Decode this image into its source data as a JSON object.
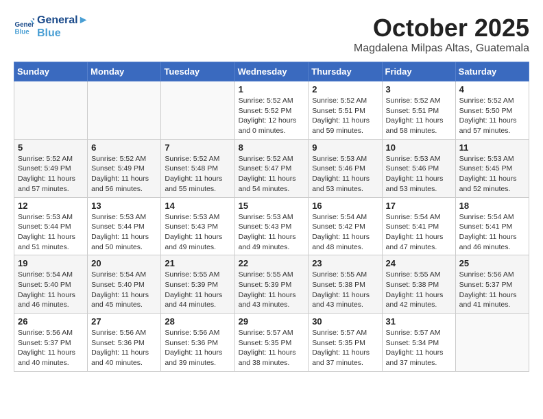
{
  "header": {
    "logo_line1": "General",
    "logo_line2": "Blue",
    "month": "October 2025",
    "location": "Magdalena Milpas Altas, Guatemala"
  },
  "weekdays": [
    "Sunday",
    "Monday",
    "Tuesday",
    "Wednesday",
    "Thursday",
    "Friday",
    "Saturday"
  ],
  "weeks": [
    [
      {
        "day": "",
        "info": ""
      },
      {
        "day": "",
        "info": ""
      },
      {
        "day": "",
        "info": ""
      },
      {
        "day": "1",
        "info": "Sunrise: 5:52 AM\nSunset: 5:52 PM\nDaylight: 12 hours\nand 0 minutes."
      },
      {
        "day": "2",
        "info": "Sunrise: 5:52 AM\nSunset: 5:51 PM\nDaylight: 11 hours\nand 59 minutes."
      },
      {
        "day": "3",
        "info": "Sunrise: 5:52 AM\nSunset: 5:51 PM\nDaylight: 11 hours\nand 58 minutes."
      },
      {
        "day": "4",
        "info": "Sunrise: 5:52 AM\nSunset: 5:50 PM\nDaylight: 11 hours\nand 57 minutes."
      }
    ],
    [
      {
        "day": "5",
        "info": "Sunrise: 5:52 AM\nSunset: 5:49 PM\nDaylight: 11 hours\nand 57 minutes."
      },
      {
        "day": "6",
        "info": "Sunrise: 5:52 AM\nSunset: 5:49 PM\nDaylight: 11 hours\nand 56 minutes."
      },
      {
        "day": "7",
        "info": "Sunrise: 5:52 AM\nSunset: 5:48 PM\nDaylight: 11 hours\nand 55 minutes."
      },
      {
        "day": "8",
        "info": "Sunrise: 5:52 AM\nSunset: 5:47 PM\nDaylight: 11 hours\nand 54 minutes."
      },
      {
        "day": "9",
        "info": "Sunrise: 5:53 AM\nSunset: 5:46 PM\nDaylight: 11 hours\nand 53 minutes."
      },
      {
        "day": "10",
        "info": "Sunrise: 5:53 AM\nSunset: 5:46 PM\nDaylight: 11 hours\nand 53 minutes."
      },
      {
        "day": "11",
        "info": "Sunrise: 5:53 AM\nSunset: 5:45 PM\nDaylight: 11 hours\nand 52 minutes."
      }
    ],
    [
      {
        "day": "12",
        "info": "Sunrise: 5:53 AM\nSunset: 5:44 PM\nDaylight: 11 hours\nand 51 minutes."
      },
      {
        "day": "13",
        "info": "Sunrise: 5:53 AM\nSunset: 5:44 PM\nDaylight: 11 hours\nand 50 minutes."
      },
      {
        "day": "14",
        "info": "Sunrise: 5:53 AM\nSunset: 5:43 PM\nDaylight: 11 hours\nand 49 minutes."
      },
      {
        "day": "15",
        "info": "Sunrise: 5:53 AM\nSunset: 5:43 PM\nDaylight: 11 hours\nand 49 minutes."
      },
      {
        "day": "16",
        "info": "Sunrise: 5:54 AM\nSunset: 5:42 PM\nDaylight: 11 hours\nand 48 minutes."
      },
      {
        "day": "17",
        "info": "Sunrise: 5:54 AM\nSunset: 5:41 PM\nDaylight: 11 hours\nand 47 minutes."
      },
      {
        "day": "18",
        "info": "Sunrise: 5:54 AM\nSunset: 5:41 PM\nDaylight: 11 hours\nand 46 minutes."
      }
    ],
    [
      {
        "day": "19",
        "info": "Sunrise: 5:54 AM\nSunset: 5:40 PM\nDaylight: 11 hours\nand 46 minutes."
      },
      {
        "day": "20",
        "info": "Sunrise: 5:54 AM\nSunset: 5:40 PM\nDaylight: 11 hours\nand 45 minutes."
      },
      {
        "day": "21",
        "info": "Sunrise: 5:55 AM\nSunset: 5:39 PM\nDaylight: 11 hours\nand 44 minutes."
      },
      {
        "day": "22",
        "info": "Sunrise: 5:55 AM\nSunset: 5:39 PM\nDaylight: 11 hours\nand 43 minutes."
      },
      {
        "day": "23",
        "info": "Sunrise: 5:55 AM\nSunset: 5:38 PM\nDaylight: 11 hours\nand 43 minutes."
      },
      {
        "day": "24",
        "info": "Sunrise: 5:55 AM\nSunset: 5:38 PM\nDaylight: 11 hours\nand 42 minutes."
      },
      {
        "day": "25",
        "info": "Sunrise: 5:56 AM\nSunset: 5:37 PM\nDaylight: 11 hours\nand 41 minutes."
      }
    ],
    [
      {
        "day": "26",
        "info": "Sunrise: 5:56 AM\nSunset: 5:37 PM\nDaylight: 11 hours\nand 40 minutes."
      },
      {
        "day": "27",
        "info": "Sunrise: 5:56 AM\nSunset: 5:36 PM\nDaylight: 11 hours\nand 40 minutes."
      },
      {
        "day": "28",
        "info": "Sunrise: 5:56 AM\nSunset: 5:36 PM\nDaylight: 11 hours\nand 39 minutes."
      },
      {
        "day": "29",
        "info": "Sunrise: 5:57 AM\nSunset: 5:35 PM\nDaylight: 11 hours\nand 38 minutes."
      },
      {
        "day": "30",
        "info": "Sunrise: 5:57 AM\nSunset: 5:35 PM\nDaylight: 11 hours\nand 37 minutes."
      },
      {
        "day": "31",
        "info": "Sunrise: 5:57 AM\nSunset: 5:34 PM\nDaylight: 11 hours\nand 37 minutes."
      },
      {
        "day": "",
        "info": ""
      }
    ]
  ]
}
